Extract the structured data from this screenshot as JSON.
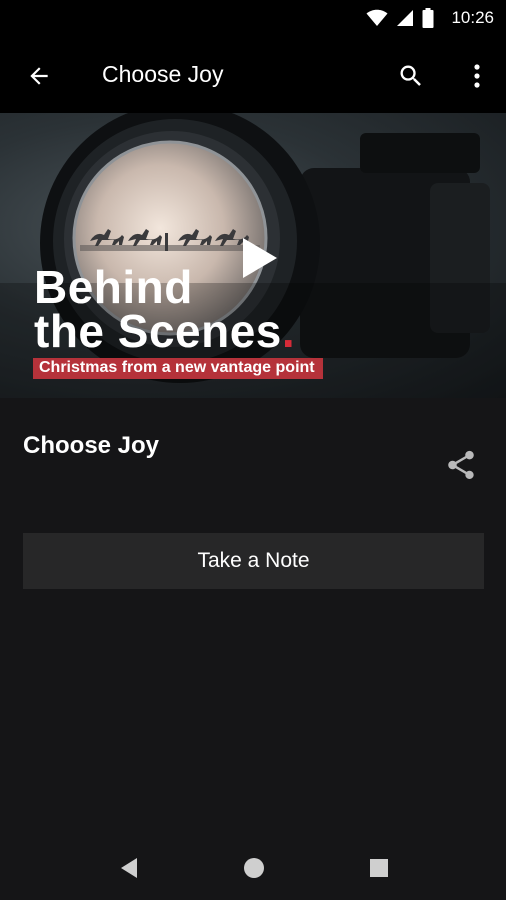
{
  "status_bar": {
    "time": "10:26",
    "icons": [
      "wifi-icon",
      "signal-icon",
      "battery-icon"
    ]
  },
  "app_bar": {
    "title": "Choose Joy",
    "icons": [
      "arrow-back-icon",
      "search-icon",
      "more-vert-icon"
    ]
  },
  "hero": {
    "headline_line1": "Behind",
    "headline_line2": "the Scenes",
    "headline_dot": ".",
    "subline": "Christmas from a new vantage point",
    "play_icon": "play-icon",
    "accent_color": "#d62b38"
  },
  "detail": {
    "title": "Choose Joy",
    "share_icon": "share-icon",
    "note_button": "Take a Note"
  },
  "nav_bar": {
    "icons": [
      "nav-back-icon",
      "nav-home-icon",
      "nav-recents-icon"
    ]
  },
  "colors": {
    "background": "#151517",
    "bar": "#000000",
    "button": "#272728"
  }
}
